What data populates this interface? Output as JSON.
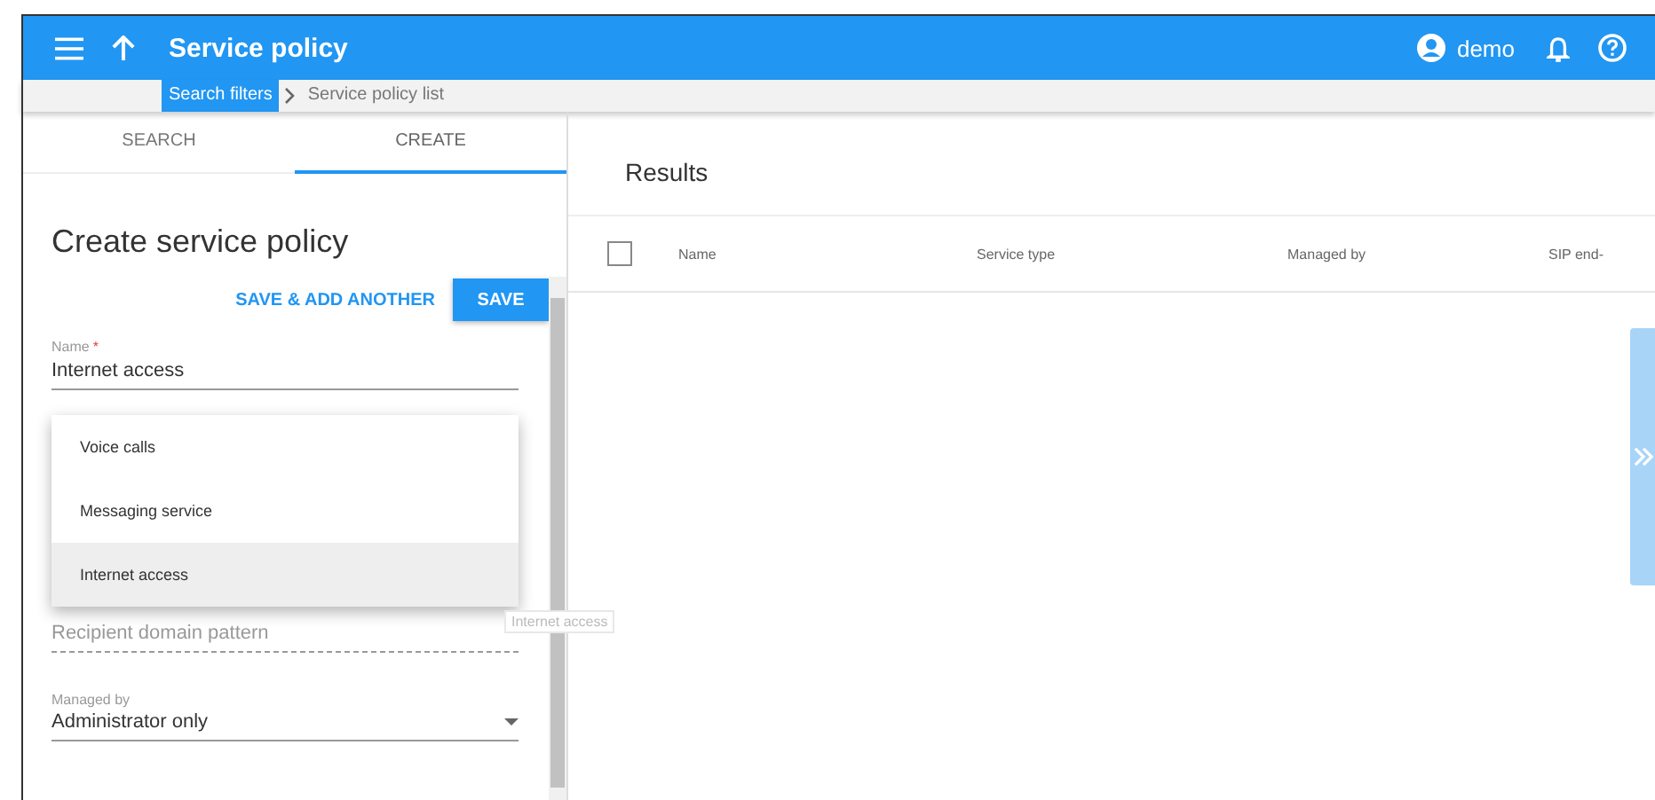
{
  "app_bar": {
    "title": "Service policy",
    "user": "demo"
  },
  "breadcrumbs": [
    {
      "label": "Search filters",
      "selected": true
    },
    {
      "label": "Service policy list",
      "selected": false
    }
  ],
  "tabs": [
    {
      "label": "SEARCH",
      "selected": false
    },
    {
      "label": "CREATE",
      "selected": true
    }
  ],
  "form": {
    "heading": "Create service policy",
    "secondary_button": "SAVE & ADD ANOTHER",
    "primary_button": "SAVE",
    "name_field": {
      "label": "Name",
      "required_mark": "*",
      "value": "Internet access"
    },
    "dropdown_options": [
      {
        "label": "Voice calls",
        "selected": false
      },
      {
        "label": "Messaging service",
        "selected": false
      },
      {
        "label": "Internet access",
        "selected": true
      }
    ],
    "tooltip": "Internet access",
    "recipient_field": {
      "placeholder": "Recipient domain pattern"
    },
    "managed_by": {
      "label": "Managed by",
      "value": "Administrator only"
    }
  },
  "results": {
    "title": "Results",
    "select_all_checked": false,
    "columns": [
      "Name",
      "Service type",
      "Managed by",
      "SIP end-"
    ]
  }
}
